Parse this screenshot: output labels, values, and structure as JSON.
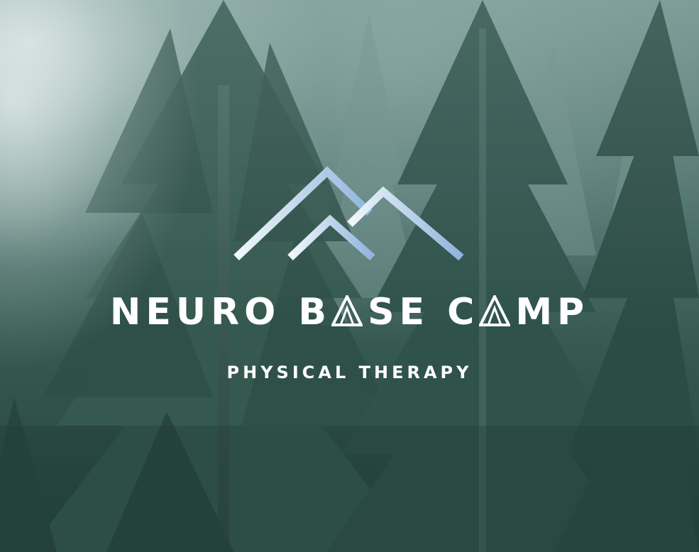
{
  "logo": {
    "name_part_1": "NEURO B",
    "name_part_2": "SE C",
    "name_part_3": "MP",
    "tent_glyph": "A-shaped tent icon replacing letter A",
    "tagline": "PHYSICAL THERAPY",
    "gradient_start": "#f2f7fb",
    "gradient_end": "#8fb4dc"
  },
  "background": {
    "subject": "misty evergreen forest",
    "tree_color": "#2c4f49",
    "fog_color": "#d6e3e0"
  }
}
